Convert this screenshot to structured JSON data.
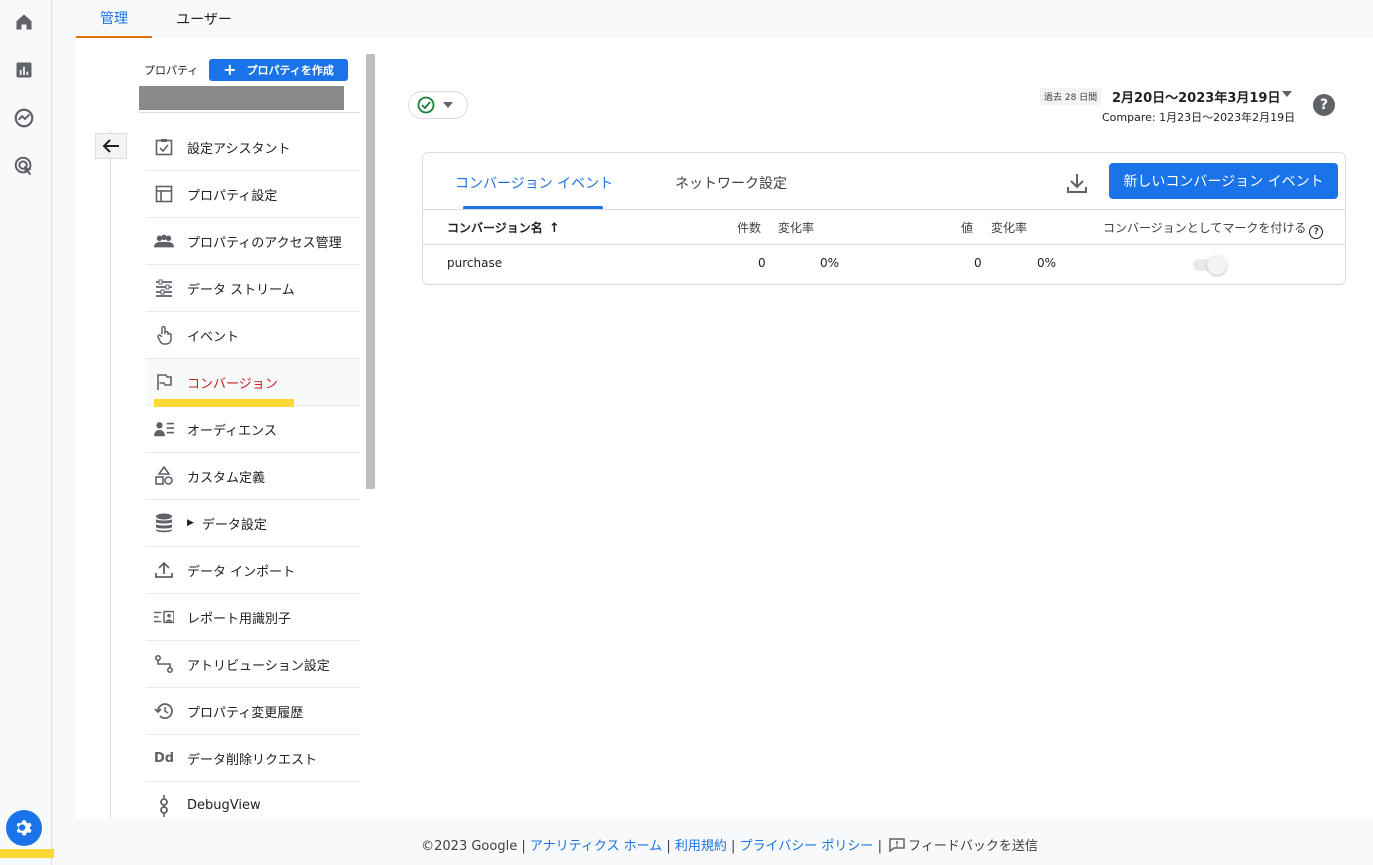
{
  "top_tabs": [
    {
      "label": "管理",
      "active": true
    },
    {
      "label": "ユーザー",
      "active": false
    }
  ],
  "rail": {
    "icons": [
      "home-icon",
      "reports-icon",
      "explore-icon",
      "advertising-icon"
    ],
    "settings_icon": "gear-icon"
  },
  "property": {
    "label": "プロパティ",
    "create_button": "プロパティを作成"
  },
  "menu": [
    {
      "label": "設定アシスタント",
      "icon": "checklist-icon"
    },
    {
      "label": "プロパティ設定",
      "icon": "property-settings-icon"
    },
    {
      "label": "プロパティのアクセス管理",
      "icon": "people-icon"
    },
    {
      "label": "データ ストリーム",
      "icon": "data-streams-icon"
    },
    {
      "label": "イベント",
      "icon": "touch-icon"
    },
    {
      "label": "コンバージョン",
      "icon": "flag-icon",
      "active": true
    },
    {
      "label": "オーディエンス",
      "icon": "audience-icon"
    },
    {
      "label": "カスタム定義",
      "icon": "shapes-icon"
    },
    {
      "label": "データ設定",
      "icon": "database-icon",
      "expandable": true
    },
    {
      "label": "データ インポート",
      "icon": "upload-icon"
    },
    {
      "label": "レポート用識別子",
      "icon": "identifier-icon"
    },
    {
      "label": "アトリビューション設定",
      "icon": "attribution-icon"
    },
    {
      "label": "プロパティ変更履歴",
      "icon": "history-icon"
    },
    {
      "label": "データ削除リクエスト",
      "icon": "dd-icon"
    },
    {
      "label": "DebugView",
      "icon": "debug-icon"
    }
  ],
  "date": {
    "badge": "過去 28 日間",
    "range": "2月20日〜2023年3月19日",
    "compare": "Compare: 1月23日〜2023年2月19日"
  },
  "card": {
    "tabs": [
      {
        "label": "コンバージョン イベント",
        "active": true
      },
      {
        "label": "ネットワーク設定",
        "active": false
      }
    ],
    "new_button": "新しいコンバージョン イベント",
    "headers": {
      "name": "コンバージョン名",
      "count": "件数",
      "count_change": "変化率",
      "value": "値",
      "value_change": "変化率",
      "mark": "コンバージョンとしてマークを付ける"
    },
    "rows": [
      {
        "name": "purchase",
        "count": "0",
        "count_change": "0%",
        "value": "0",
        "value_change": "0%",
        "marked": false
      }
    ]
  },
  "footer": {
    "copyright": "©2023 Google",
    "sep": "|",
    "link1": "アナリティクス ホーム",
    "link2": "利用規約",
    "link3": "プライバシー ポリシー",
    "feedback": "フィードバックを送信"
  },
  "colors": {
    "accent": "#1a73e8",
    "active_menu": "#c5221f",
    "highlight": "#fdd835",
    "tab_underline": "#e8710a"
  }
}
